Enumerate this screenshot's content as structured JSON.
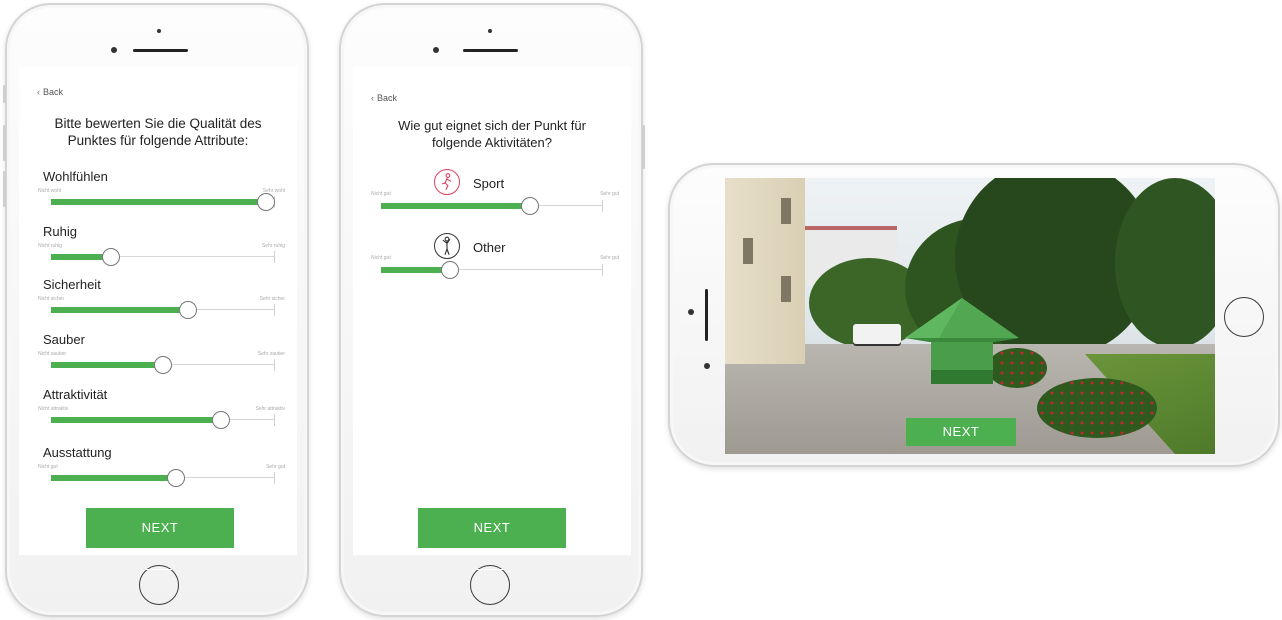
{
  "colors": {
    "accent": "#4caf50",
    "sport_icon": "#e04060"
  },
  "screen1": {
    "back": "Back",
    "title_line1": "Bitte bewerten Sie die Qualität des",
    "title_line2": "Punktes für folgende Attribute:",
    "attributes": [
      {
        "label": "Wohlfühlen",
        "low": "Nicht wohl",
        "high": "Sehr wohl",
        "value": 0.96
      },
      {
        "label": "Ruhig",
        "low": "Nicht ruhig",
        "high": "Sehr ruhig",
        "value": 0.27
      },
      {
        "label": "Sicherheit",
        "low": "Nicht sicher",
        "high": "Sehr sicher",
        "value": 0.61
      },
      {
        "label": "Sauber",
        "low": "Nicht sauber",
        "high": "Sehr sauber",
        "value": 0.5
      },
      {
        "label": "Attraktivität",
        "low": "Nicht attraktiv",
        "high": "Sehr attraktiv",
        "value": 0.76
      },
      {
        "label": "Ausstattung",
        "low": "Nicht gut",
        "high": "Sehr gut",
        "value": 0.56
      }
    ],
    "next": "NEXT"
  },
  "screen2": {
    "back": "Back",
    "title_line1": "Wie gut eignet sich der Punkt für",
    "title_line2": "folgende Aktivitäten?",
    "activities": [
      {
        "label": "Sport",
        "icon": "running-icon",
        "low": "Nicht gut",
        "high": "Sehr gut",
        "value": 0.67
      },
      {
        "label": "Other",
        "icon": "standing-icon",
        "low": "Nicht gut",
        "high": "Sehr gut",
        "value": 0.31
      }
    ],
    "next": "NEXT"
  },
  "screen3": {
    "next": "NEXT",
    "arrow_icon": "forward-arrow-icon"
  }
}
